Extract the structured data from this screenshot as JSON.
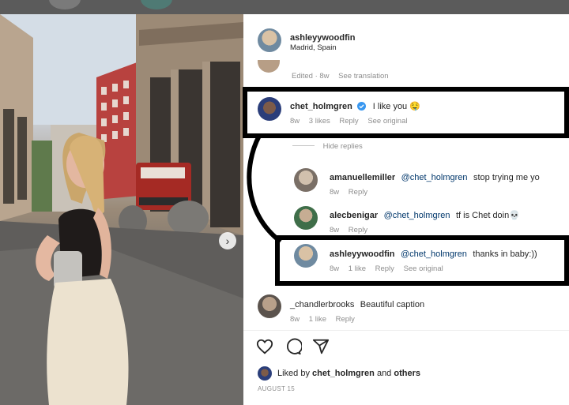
{
  "post": {
    "username": "ashleyywoodfin",
    "location": "Madrid, Spain",
    "caption_meta": {
      "edited": "Edited · 8w",
      "translation": "See translation"
    }
  },
  "comments": [
    {
      "username": "chet_holmgren",
      "verified": true,
      "text": "I like you 🤤",
      "meta": {
        "age": "8w",
        "likes": "3 likes",
        "reply": "Reply",
        "original": "See original"
      }
    },
    {
      "username": "amanuellemiller",
      "mention": "@chet_holmgren",
      "text": "stop trying me yo",
      "meta": {
        "age": "8w",
        "reply": "Reply"
      }
    },
    {
      "username": "alecbenigar",
      "mention": "@chet_holmgren",
      "text": "tf is Chet doin💀",
      "meta": {
        "age": "8w",
        "reply": "Reply"
      }
    },
    {
      "username": "ashleyywoodfin",
      "mention": "@chet_holmgren",
      "text": "thanks in baby:))",
      "meta": {
        "age": "8w",
        "likes": "1 like",
        "reply": "Reply",
        "original": "See original"
      }
    },
    {
      "username": "_chandlerbrooks",
      "text": "Beautiful caption",
      "meta": {
        "age": "8w",
        "likes": "1 like",
        "reply": "Reply"
      }
    }
  ],
  "hide_replies": "Hide replies",
  "liked_by": {
    "prefix": "Liked by ",
    "user": "chet_holmgren",
    "and": " and ",
    "others": "others"
  },
  "date": "AUGUST 15",
  "icons": [
    "heart-icon",
    "comment-icon",
    "share-icon",
    "verified-icon",
    "next-arrow-icon"
  ],
  "colors": {
    "verified": "#3897f0",
    "mention": "#00376b",
    "meta": "#8e8e8e",
    "highlight_box": "#000000"
  }
}
